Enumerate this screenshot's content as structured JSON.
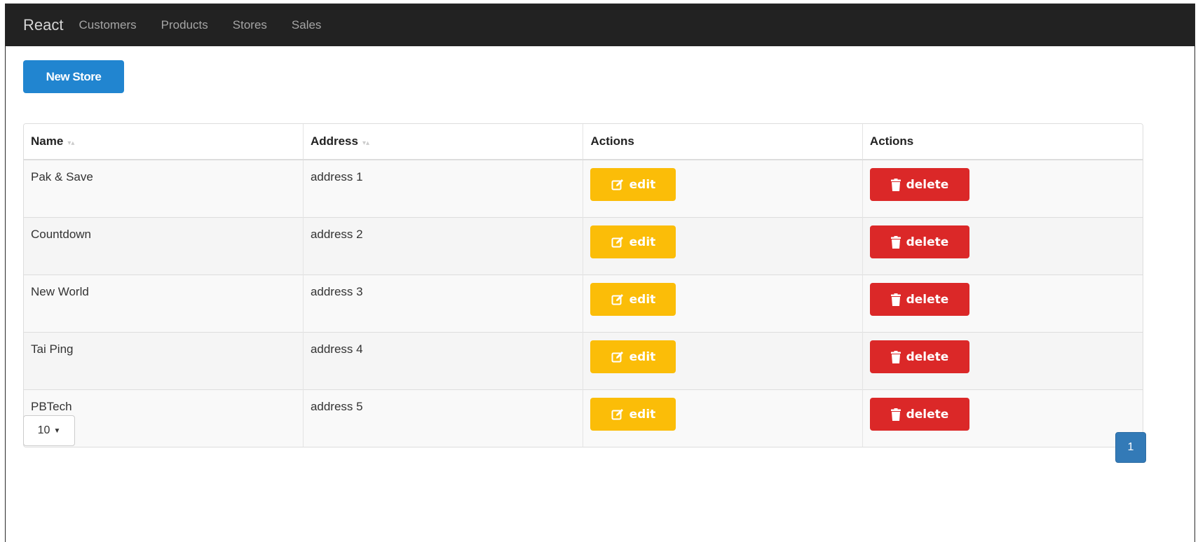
{
  "navbar": {
    "brand": "React",
    "links": [
      "Customers",
      "Products",
      "Stores",
      "Sales"
    ]
  },
  "toolbar": {
    "new_store_label": "New Store"
  },
  "table": {
    "headers": {
      "name": "Name",
      "address": "Address",
      "actions_1": "Actions",
      "actions_2": "Actions"
    },
    "rows": [
      {
        "name": "Pak & Save",
        "address": "address 1"
      },
      {
        "name": "Countdown",
        "address": "address 2"
      },
      {
        "name": "New World",
        "address": "address 3"
      },
      {
        "name": "Tai Ping",
        "address": "address 4"
      },
      {
        "name": "PBTech",
        "address": "address 5"
      }
    ],
    "edit_label": "edit",
    "delete_label": "delete",
    "edit_icon": "edit-icon",
    "delete_icon": "trash-icon"
  },
  "pagination": {
    "per_page": "10",
    "current_page": "1"
  },
  "colors": {
    "navbar": "#222222",
    "primary": "#2185d0",
    "edit": "#fbbd08",
    "delete": "#db2828",
    "page": "#337ab7"
  }
}
